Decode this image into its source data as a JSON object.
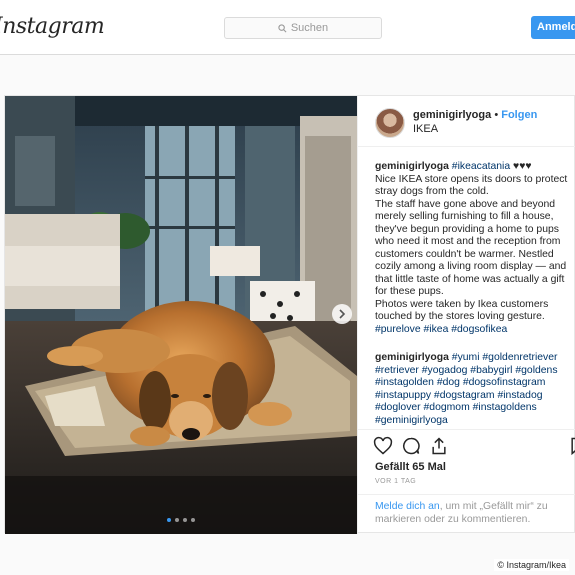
{
  "header": {
    "logo": "Instagram",
    "search_placeholder": "Suchen",
    "login_label": "Anmelden"
  },
  "post": {
    "username": "geminigirlyoga",
    "separator": "•",
    "follow_label": "Folgen",
    "location": "IKEA",
    "caption": {
      "username": "geminigirlyoga",
      "tag": "#ikeacatania",
      "hearts": " ♥♥♥",
      "body": [
        "Nice IKEA store opens its doors to protect stray dogs from the cold.",
        "The staff have gone above and beyond merely selling furnishing to fill a house, they've begun providing a home to pups who need it most and the reception from customers couldn't be warmer. Nestled cozily among a living room display — and that little taste of home was actually a gift for these pups.",
        "Photos were taken by Ikea customers touched by the stores loving gesture.",
        "#purelove #ikea #dogsofikea"
      ]
    },
    "comment": {
      "username": "geminigirlyoga",
      "first_tag": "#yumi",
      "tags": "#goldenretriever #retriever #yogadog #babygirl #goldens #instagolden #dog #dogsofinstagram #instapuppy #dogstagram #instadog #doglover #dogmom #instagoldens #geminigirlyoga"
    },
    "likes": "Gefällt 65 Mal",
    "date": "VOR 1 TAG",
    "login_prompt_link": "Melde dich an",
    "login_prompt_rest": ", um mit „Gefällt mir“ zu markieren oder zu kommentieren.",
    "carousel_dots": 4,
    "carousel_active": 0
  },
  "credit": "© Instagram/Ikea",
  "icons": [
    "search-icon",
    "heart-icon",
    "comment-icon",
    "share-icon",
    "bookmark-icon",
    "chevron-right-icon"
  ],
  "colors": {
    "accent": "#3897f0",
    "border": "#dbdbdb",
    "text": "#262626",
    "muted": "#999999"
  }
}
